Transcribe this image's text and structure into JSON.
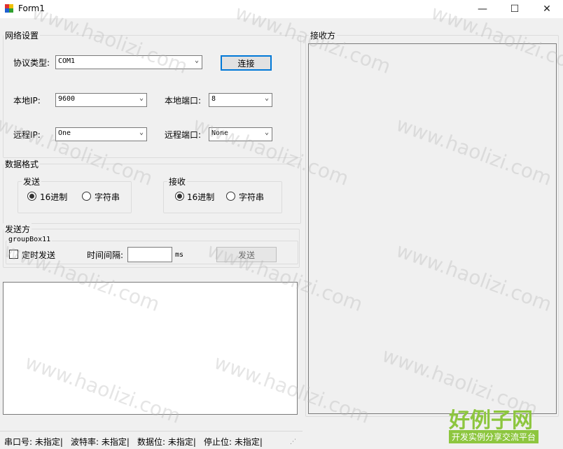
{
  "window": {
    "title": "Form1",
    "minimize_glyph": "—",
    "maximize_glyph": "☐",
    "close_glyph": "✕"
  },
  "network": {
    "title": "网络设置",
    "protocol_label": "协议类型:",
    "protocol_value": "COM1",
    "connect_label": "连接",
    "local_ip_label": "本地IP:",
    "local_ip_value": "9600",
    "local_port_label": "本地端口:",
    "local_port_value": "8",
    "remote_ip_label": "远程IP:",
    "remote_ip_value": "One",
    "remote_port_label": "远程端口:",
    "remote_port_value": "None"
  },
  "format": {
    "title": "数据格式",
    "send_title": "发送",
    "send_hex_label": "16进制",
    "send_str_label": "字符串",
    "send_selected": "hex",
    "recv_title": "接收",
    "recv_hex_label": "16进制",
    "recv_str_label": "字符串",
    "recv_selected": "hex"
  },
  "sender": {
    "title": "发送方",
    "group_title": "groupBox11",
    "timed_send_label": "定时发送",
    "timed_send_checked": false,
    "interval_label": "时间间隔:",
    "interval_value": "",
    "interval_unit": "ms",
    "send_button_label": "发送",
    "send_text": ""
  },
  "receiver": {
    "title": "接收方",
    "text": ""
  },
  "status": {
    "port": "串口号: 未指定|",
    "baud": "波特率: 未指定|",
    "data_bits": "数据位: 未指定|",
    "stop_bits": "停止位: 未指定|"
  },
  "watermark": {
    "text": "www.haolizi.com",
    "logo_top": "好例子网",
    "logo_bottom": "开发实例分享交流平台"
  },
  "colors": {
    "accent": "#0078d7",
    "logo_green": "#8dc63f",
    "window_bg": "#f0f0f0"
  }
}
